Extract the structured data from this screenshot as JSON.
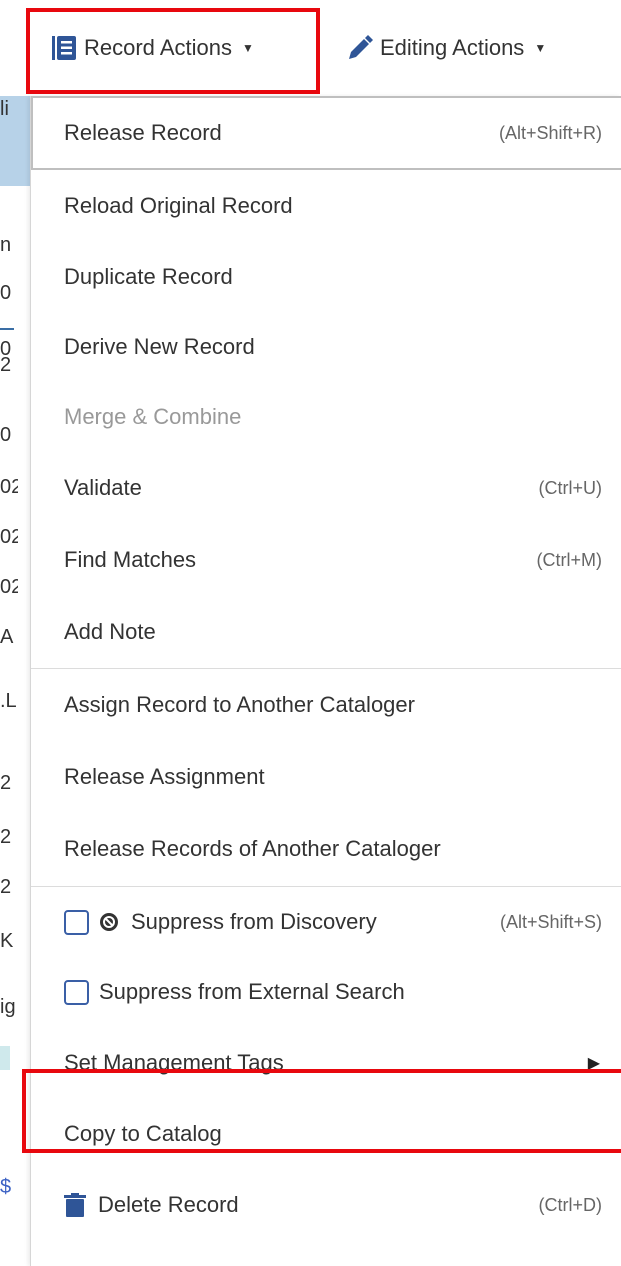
{
  "toolbar": {
    "record_actions_label": "Record Actions",
    "editing_actions_label": "Editing Actions"
  },
  "menu": {
    "release_record": {
      "label": "Release Record",
      "shortcut": "(Alt+Shift+R)"
    },
    "reload_original": {
      "label": "Reload Original Record"
    },
    "duplicate": {
      "label": "Duplicate Record"
    },
    "derive_new": {
      "label": "Derive New Record"
    },
    "merge_combine": {
      "label": "Merge & Combine"
    },
    "validate": {
      "label": "Validate",
      "shortcut": "(Ctrl+U)"
    },
    "find_matches": {
      "label": "Find Matches",
      "shortcut": "(Ctrl+M)"
    },
    "add_note": {
      "label": "Add Note"
    },
    "assign_record": {
      "label": "Assign Record to Another Cataloger"
    },
    "release_assignment": {
      "label": "Release Assignment"
    },
    "release_records_other": {
      "label": "Release Records of Another Cataloger"
    },
    "suppress_discovery": {
      "label": "Suppress from Discovery",
      "shortcut": "(Alt+Shift+S)"
    },
    "suppress_external": {
      "label": "Suppress from External Search"
    },
    "management_tags": {
      "label": "Set Management Tags"
    },
    "copy_to_catalog": {
      "label": "Copy to Catalog"
    },
    "delete_record": {
      "label": "Delete Record",
      "shortcut": "(Ctrl+D)"
    }
  },
  "background": {
    "fragments": [
      "li",
      "n",
      "0",
      "0",
      "2",
      "0",
      "02",
      "02",
      "02",
      "A",
      ".L",
      "2",
      "2",
      "2",
      "K",
      "ig",
      "$"
    ]
  },
  "colors": {
    "highlight": "#e8080e",
    "checkbox_border": "#3a5fa6",
    "icon_blue": "#2f5597"
  },
  "icons": {
    "record_actions": "list-book-icon",
    "editing_actions": "pencil-icon",
    "suppress": "block-icon",
    "submenu": "caret-right-icon",
    "delete": "trash-icon"
  }
}
